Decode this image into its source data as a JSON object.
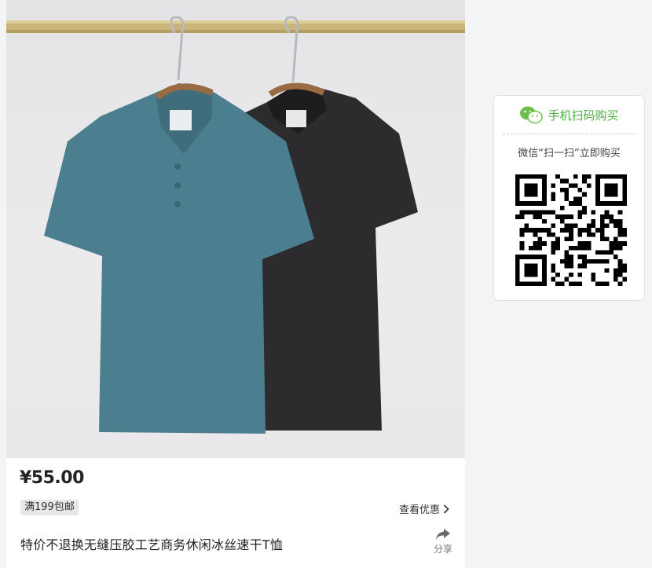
{
  "product": {
    "image_alt": "两件短袖POLO衫挂在衣架上",
    "price": "¥55.00",
    "promo_tag": "满199包邮",
    "coupon_link": "查看优惠",
    "title": "特价不退换无缝压胶工艺商务休闲冰丝速干T恤",
    "share_label": "分享"
  },
  "qr_panel": {
    "header": "手机扫码购买",
    "subtitle": "微信“扫一扫”立即购买"
  },
  "colors": {
    "accent_green": "#4cae3e",
    "shirt_teal": "#4a7e8e",
    "shirt_black": "#2b2b2d"
  },
  "icons": {
    "chevron": "chevron-right-icon",
    "share": "share-arrow-icon",
    "wechat": "wechat-icon"
  }
}
